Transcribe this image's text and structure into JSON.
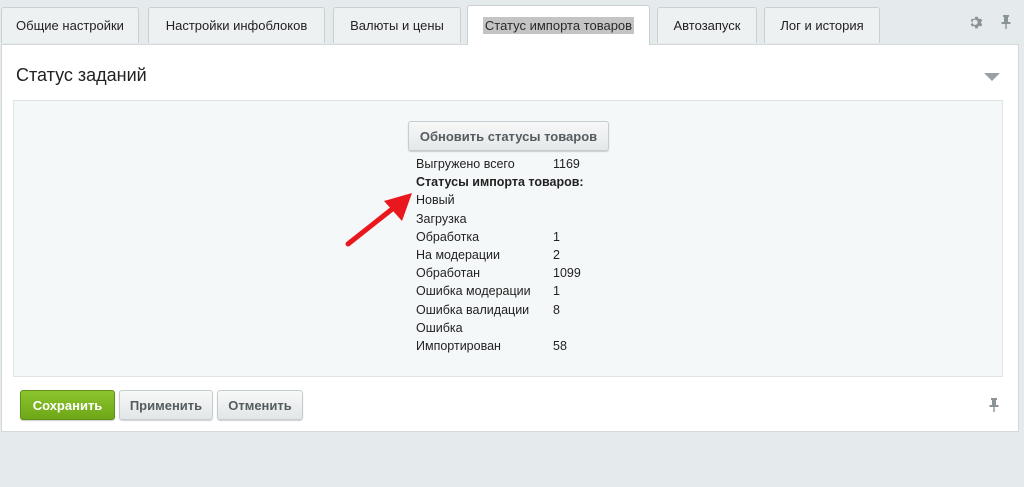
{
  "tabs": [
    {
      "label": "Общие настройки"
    },
    {
      "label": "Настройки инфоблоков"
    },
    {
      "label": "Валюты и цены"
    },
    {
      "label": "Статус импорта товаров"
    },
    {
      "label": "Автозапуск"
    },
    {
      "label": "Лог и история"
    }
  ],
  "active_tab": "Статус импорта товаров",
  "tab_icons": [
    "gear-icon",
    "pin-icon"
  ],
  "section": {
    "title": "Статус заданий",
    "refresh_button": "Обновить статусы товаров",
    "total_label": "Выгружено всего",
    "total_value": "1169",
    "statuses_heading": "Статусы импорта товаров:",
    "statuses": [
      {
        "label": "Новый",
        "value": ""
      },
      {
        "label": "Загрузка",
        "value": ""
      },
      {
        "label": "Обработка",
        "value": "1"
      },
      {
        "label": "На модерации",
        "value": "2"
      },
      {
        "label": "Обработан",
        "value": "1099"
      },
      {
        "label": "Ошибка модерации",
        "value": "1"
      },
      {
        "label": "Ошибка валидации",
        "value": "8"
      },
      {
        "label": "Ошибка",
        "value": ""
      },
      {
        "label": "Импортирован",
        "value": "58"
      }
    ]
  },
  "footer": {
    "save_label": "Сохранить",
    "apply_label": "Применить",
    "cancel_label": "Отменить"
  },
  "colors": {
    "save_button": "#7cb622",
    "arrow": "#e8181e",
    "background": "#e5eaec"
  }
}
